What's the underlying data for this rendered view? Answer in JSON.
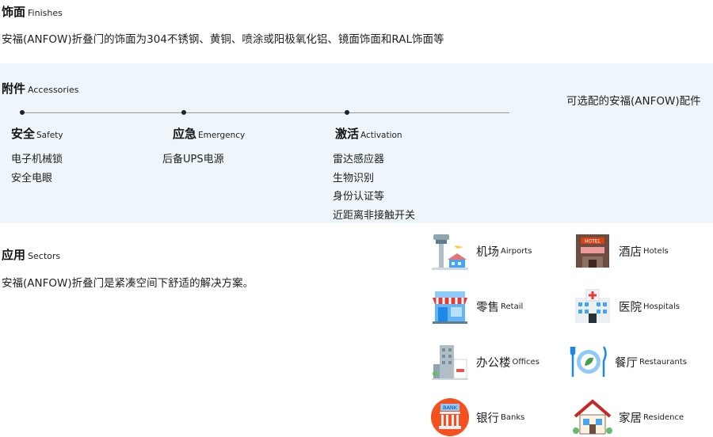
{
  "finishes": {
    "title": "饰面",
    "subtitle": "Finishes",
    "text": "安福(ANFOW)折叠门的饰面为304不锈钢、黄铜、喷涂或阳极氧化铝、镜面饰面和RAL饰面等"
  },
  "accessories": {
    "title": "附件",
    "subtitle": "Accessories",
    "optional_text": "可选配的安福(ANFOW)配件",
    "columns": [
      {
        "title": "安全",
        "subtitle": "Safety",
        "items": [
          "电子机械锁",
          "安全电眼"
        ]
      },
      {
        "title": "应急",
        "subtitle": "Emergency",
        "items": [
          "后备UPS电源"
        ]
      },
      {
        "title": "激活",
        "subtitle": "Activation",
        "items": [
          "雷达感应器",
          "生物识别",
          "身份认证等",
          "近距离非接触开关"
        ]
      }
    ]
  },
  "sectors": {
    "title": "应用",
    "subtitle": "Sectors",
    "text": "安福(ANFOW)折叠门是紧凑空间下舒适的解决方案。",
    "items": [
      {
        "zh": "机场",
        "en": "Airports",
        "icon": "airport-icon"
      },
      {
        "zh": "酒店",
        "en": "Hotels",
        "icon": "hotel-icon"
      },
      {
        "zh": "零售",
        "en": "Retail",
        "icon": "retail-store-icon"
      },
      {
        "zh": "医院",
        "en": "Hospitals",
        "icon": "hospital-icon"
      },
      {
        "zh": "办公楼",
        "en": "Offices",
        "icon": "office-building-icon"
      },
      {
        "zh": "餐厅",
        "en": "Restaurants",
        "icon": "restaurant-icon"
      },
      {
        "zh": "银行",
        "en": "Banks",
        "icon": "bank-icon"
      },
      {
        "zh": "家居",
        "en": "Residence",
        "icon": "house-icon"
      }
    ]
  }
}
